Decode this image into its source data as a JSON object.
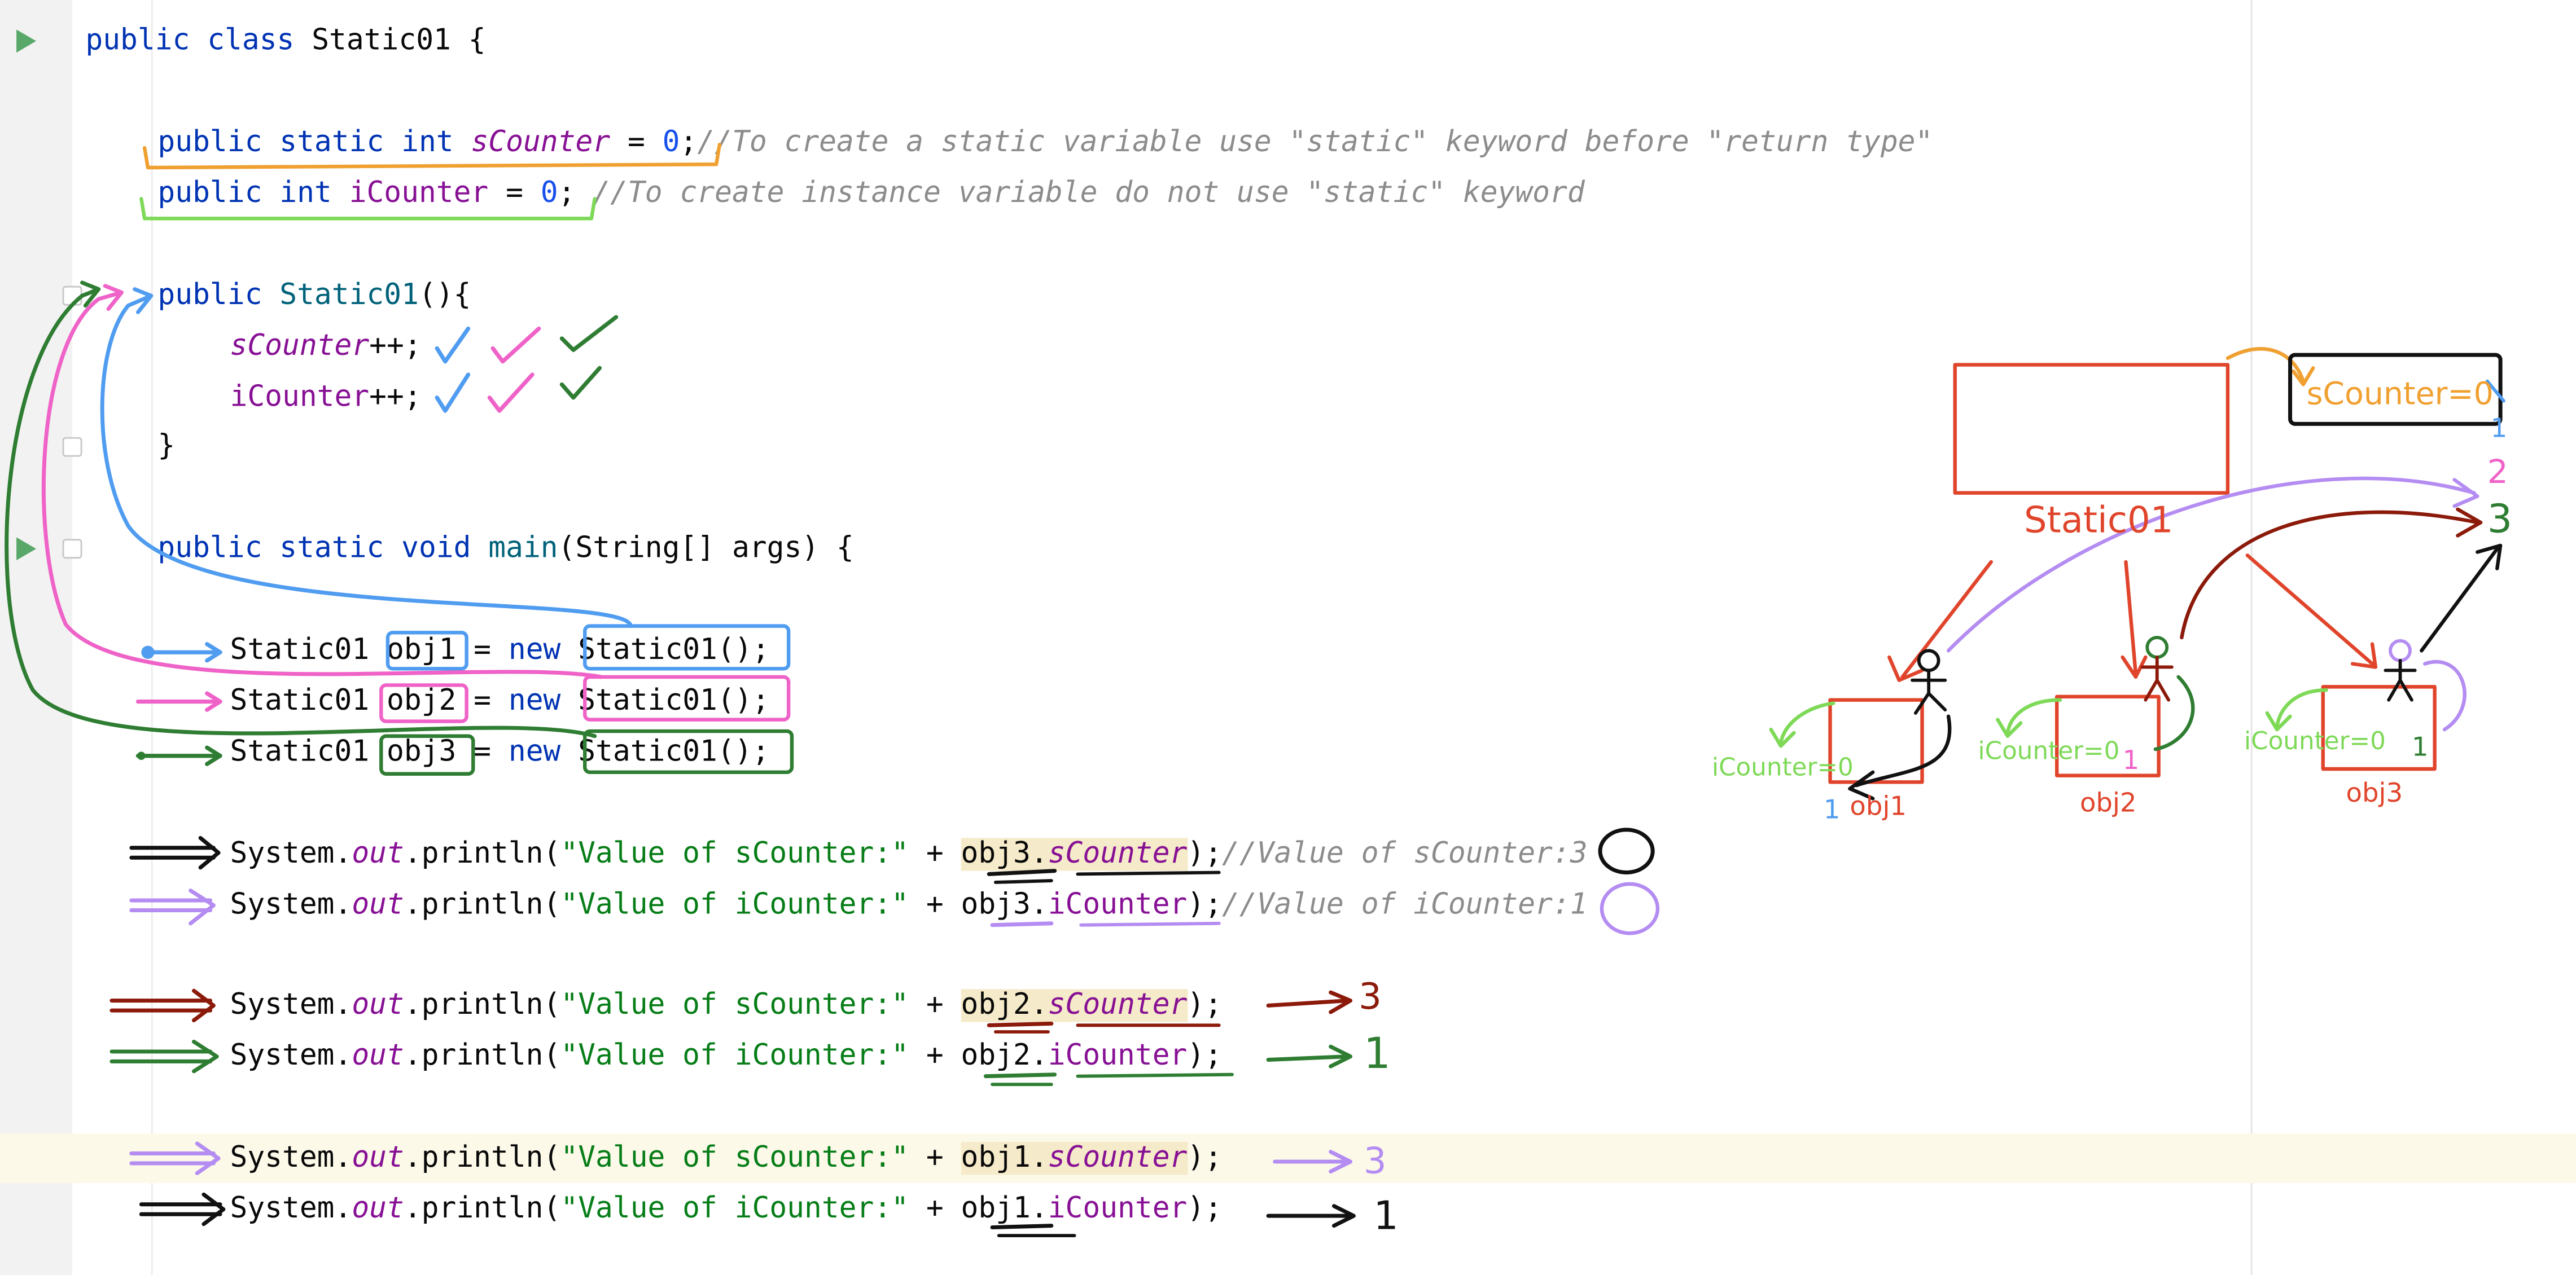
{
  "editor": {
    "lines": {
      "class_decl": [
        "public",
        " ",
        "class",
        " Static01 {"
      ],
      "scounter_decl": [
        "public",
        " ",
        "static",
        " ",
        "int",
        " ",
        "sCounter",
        " = ",
        "0",
        ";",
        "//To create a static variable use \"static\" keyword before \"return type\""
      ],
      "icounter_decl": [
        "public",
        " ",
        "int",
        " ",
        "iCounter",
        " = ",
        "0",
        "; ",
        "//To create instance variable do not use \"static\" keyword"
      ],
      "ctor_decl": [
        "public",
        " ",
        "Static01",
        "(){"
      ],
      "ctor_scounter": [
        "sCounter",
        "++;"
      ],
      "ctor_icounter": [
        "iCounter",
        "++;"
      ],
      "ctor_close": [
        "}"
      ],
      "main_decl": [
        "public",
        " ",
        "static",
        " ",
        "void",
        " ",
        "main",
        "(String[] args) {"
      ],
      "obj1_decl": [
        "Static01 ",
        "obj1",
        " = ",
        "new",
        " ",
        "Static01();"
      ],
      "obj2_decl": [
        "Static01 ",
        "obj2",
        " = ",
        "new",
        " ",
        "Static01();"
      ],
      "obj3_decl": [
        "Static01 ",
        "obj3",
        " = ",
        "new",
        " ",
        "Static01();"
      ],
      "print1": [
        "System.",
        "out",
        ".println(",
        "\"Value of sCounter:\"",
        " + ",
        "obj3",
        ".",
        "sCounter",
        ");",
        "//Value of sCounter",
        ":",
        "3"
      ],
      "print2": [
        "System.",
        "out",
        ".println(",
        "\"Value of iCounter:\"",
        " + ",
        "obj3",
        ".",
        "iCounter",
        ");",
        "//Value of iCounter",
        ":",
        "1"
      ],
      "print3": [
        "System.",
        "out",
        ".println(",
        "\"Value of sCounter:\"",
        " + ",
        "obj2",
        ".",
        "sCounter",
        ");"
      ],
      "print4": [
        "System.",
        "out",
        ".println(",
        "\"Value of iCounter:\"",
        " + ",
        "obj2",
        ".",
        "iCounter",
        ");"
      ],
      "print5": [
        "System.",
        "out",
        ".println(",
        "\"Value of sCounter:\"",
        " + ",
        "obj1",
        ".",
        "sCounter",
        ");"
      ],
      "print6": [
        "System.",
        "out",
        ".println(",
        "\"Value of iCounter:\"",
        " + ",
        "obj1",
        ".",
        "iCounter",
        ");"
      ]
    }
  },
  "annotations": {
    "results": {
      "print3": "3",
      "print4": "1",
      "print5": "3",
      "print6": "1"
    },
    "diagram": {
      "class_label": "Static01",
      "static_var_label": "sCounter=0",
      "static_values": [
        "1",
        "2",
        "3"
      ],
      "objects": [
        {
          "label": "obj1",
          "var_label": "iCounter=0",
          "new_value": "1"
        },
        {
          "label": "obj2",
          "var_label": "iCounter=0",
          "new_value": "1"
        },
        {
          "label": "obj3",
          "var_label": "iCounter=0",
          "new_value": "1"
        }
      ]
    },
    "colors": {
      "obj1": "#4f9cf0",
      "obj2": "#ef62c8",
      "obj3": "#2e7d32",
      "static": "#f0a030",
      "instance": "#7ed957",
      "diagram": "#e0452c",
      "purple": "#b48cf2",
      "darkred": "#8b1a0a",
      "ink": "#111111"
    }
  }
}
